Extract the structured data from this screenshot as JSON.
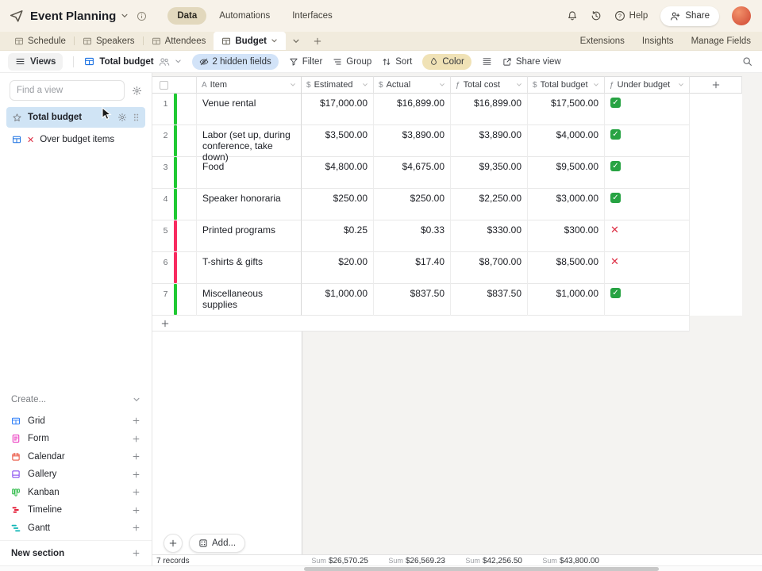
{
  "colors": {
    "green_bar": "#20c933",
    "red_bar": "#f82b60",
    "check_green": "#27a343",
    "cross_red": "#dd2e44",
    "grid_icon_blue": "#166ee1",
    "grid": "#2d7ff9",
    "form": "#e929ba",
    "calendar": "#e8432e",
    "gallery": "#7c39ed",
    "kanban": "#17b335",
    "timeline": "#e5233d",
    "gantt": "#0fb6b6"
  },
  "topbar": {
    "title": "Event Planning",
    "tabs": [
      {
        "label": "Data",
        "active": true
      },
      {
        "label": "Automations",
        "active": false
      },
      {
        "label": "Interfaces",
        "active": false
      }
    ],
    "help_label": "Help",
    "share_label": "Share"
  },
  "tablebar": {
    "tables": [
      "Schedule",
      "Speakers",
      "Attendees",
      "Budget"
    ],
    "active_table": "Budget",
    "links": [
      "Extensions",
      "Insights",
      "Manage Fields"
    ]
  },
  "toolbar": {
    "views_label": "Views",
    "current_view": "Total budget",
    "hidden_fields": "2 hidden fields",
    "filter": "Filter",
    "group": "Group",
    "sort": "Sort",
    "color": "Color",
    "share_view": "Share view"
  },
  "sidebar": {
    "find_placeholder": "Find a view",
    "views": [
      {
        "name": "Total budget",
        "selected": true
      },
      {
        "name": "Over budget items",
        "prefix": "✕",
        "selected": false
      }
    ],
    "create_label": "Create...",
    "create_items": [
      {
        "label": "Grid"
      },
      {
        "label": "Form"
      },
      {
        "label": "Calendar"
      },
      {
        "label": "Gallery"
      },
      {
        "label": "Kanban"
      },
      {
        "label": "Timeline"
      },
      {
        "label": "Gantt"
      }
    ],
    "new_section": "New section"
  },
  "grid": {
    "columns": [
      {
        "label": "Item",
        "type": "text"
      },
      {
        "label": "Estimated",
        "type": "currency"
      },
      {
        "label": "Actual",
        "type": "currency"
      },
      {
        "label": "Total cost",
        "type": "formula"
      },
      {
        "label": "Total budget",
        "type": "currency"
      },
      {
        "label": "Under budget",
        "type": "formula"
      }
    ],
    "rows": [
      {
        "num": 1,
        "item": "Venue rental",
        "estimated": "$17,000.00",
        "actual": "$16,899.00",
        "total_cost": "$16,899.00",
        "total_budget": "$17,500.00",
        "under_budget": true,
        "bar": "green"
      },
      {
        "num": 2,
        "item": "Labor (set up, during conference, take down)",
        "estimated": "$3,500.00",
        "actual": "$3,890.00",
        "total_cost": "$3,890.00",
        "total_budget": "$4,000.00",
        "under_budget": true,
        "bar": "green"
      },
      {
        "num": 3,
        "item": "Food",
        "estimated": "$4,800.00",
        "actual": "$4,675.00",
        "total_cost": "$9,350.00",
        "total_budget": "$9,500.00",
        "under_budget": true,
        "bar": "green"
      },
      {
        "num": 4,
        "item": "Speaker honoraria",
        "estimated": "$250.00",
        "actual": "$250.00",
        "total_cost": "$2,250.00",
        "total_budget": "$3,000.00",
        "under_budget": true,
        "bar": "green"
      },
      {
        "num": 5,
        "item": "Printed programs",
        "estimated": "$0.25",
        "actual": "$0.33",
        "total_cost": "$330.00",
        "total_budget": "$300.00",
        "under_budget": false,
        "bar": "red"
      },
      {
        "num": 6,
        "item": "T-shirts & gifts",
        "estimated": "$20.00",
        "actual": "$17.40",
        "total_cost": "$8,700.00",
        "total_budget": "$8,500.00",
        "under_budget": false,
        "bar": "red"
      },
      {
        "num": 7,
        "item": "Miscellaneous supplies",
        "estimated": "$1,000.00",
        "actual": "$837.50",
        "total_cost": "$837.50",
        "total_budget": "$1,000.00",
        "under_budget": true,
        "bar": "green"
      }
    ],
    "records_label": "7 records",
    "sum_label": "Sum",
    "sums": {
      "estimated": "$26,570.25",
      "actual": "$26,569.23",
      "total_cost": "$42,256.50",
      "total_budget": "$43,800.00"
    },
    "add_label": "Add..."
  }
}
